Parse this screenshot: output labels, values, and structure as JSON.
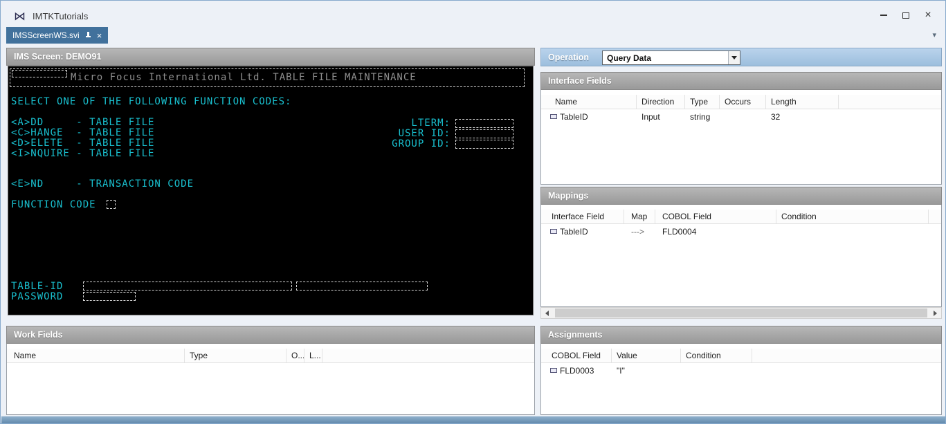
{
  "window": {
    "title": "IMTKTutorials",
    "close_glyph": "×",
    "tab_overflow_glyph": "▾"
  },
  "tabs": [
    {
      "label": "IMSScreenWS.svi",
      "close_glyph": "×"
    }
  ],
  "ims_screen": {
    "title": "IMS Screen: DEMO91",
    "banner": "Micro Focus International Ltd. TABLE FILE MAINTENANCE",
    "select_line": "SELECT ONE OF THE FOLLOWING FUNCTION CODES:",
    "menu": [
      "<A>DD     - TABLE FILE",
      "<C>HANGE  - TABLE FILE",
      "<D>ELETE  - TABLE FILE",
      "<I>NQUIRE - TABLE FILE"
    ],
    "right_labels": [
      "LTERM:",
      "USER ID:",
      "GROUP ID:"
    ],
    "end_line": "<E>ND     - TRANSACTION CODE",
    "function_code_label": "FUNCTION CODE",
    "table_id_label": "TABLE-ID",
    "password_label": "PASSWORD"
  },
  "work_fields": {
    "title": "Work Fields",
    "columns": [
      "Name",
      "Type",
      "O...",
      "L..."
    ],
    "rows": []
  },
  "operation": {
    "label": "Operation",
    "selected": "Query Data"
  },
  "interface_fields": {
    "title": "Interface Fields",
    "columns": [
      "Name",
      "Direction",
      "Type",
      "Occurs",
      "Length"
    ],
    "rows": [
      {
        "name": "TableID",
        "direction": "Input",
        "type": "string",
        "occurs": "",
        "length": "32"
      }
    ]
  },
  "mappings": {
    "title": "Mappings",
    "columns": [
      "Interface Field",
      "Map",
      "COBOL Field",
      "Condition"
    ],
    "rows": [
      {
        "interface_field": "TableID",
        "map": "--->",
        "cobol_field": "FLD0004",
        "condition": ""
      }
    ]
  },
  "assignments": {
    "title": "Assignments",
    "columns": [
      "COBOL Field",
      "Value",
      "Condition"
    ],
    "rows": [
      {
        "cobol_field": "FLD0003",
        "value": "\"I\"",
        "condition": ""
      }
    ]
  },
  "colors": {
    "terminal_text": "#19c0cf",
    "terminal_dim": "#8f8f8f",
    "tab_active": "#41719c",
    "operation_bar": "#a9c6e2"
  }
}
